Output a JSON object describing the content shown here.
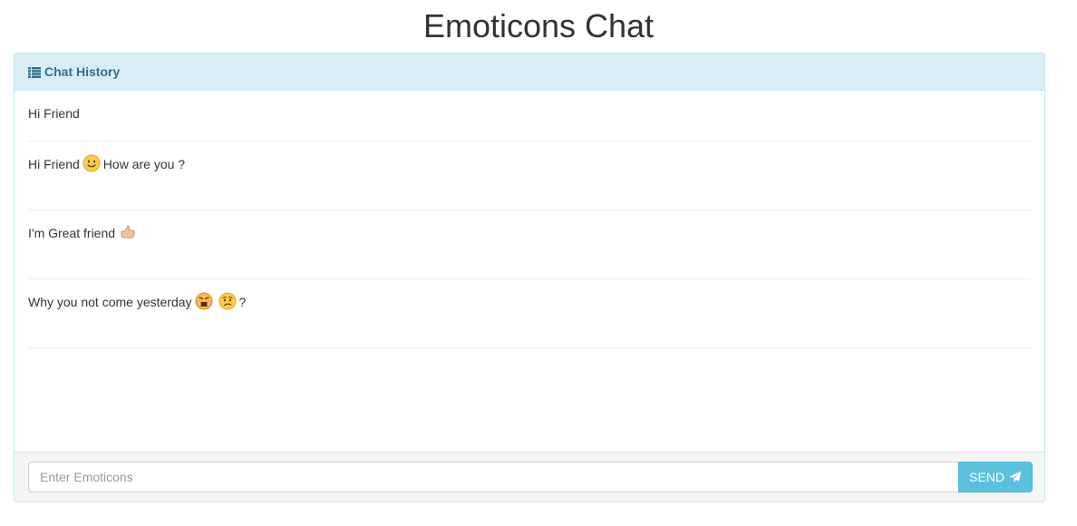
{
  "page": {
    "title": "Emoticons Chat"
  },
  "panel": {
    "heading": "Chat History",
    "heading_icon": "list-icon"
  },
  "messages": [
    {
      "parts": [
        {
          "text": "Hi Friend"
        }
      ]
    },
    {
      "parts": [
        {
          "text": "Hi Friend"
        },
        {
          "emoji": "smile-emoji-icon"
        },
        {
          "text": "How are you ?"
        }
      ]
    },
    {
      "parts": [
        {
          "text": "I'm Great friend"
        },
        {
          "emoji": "thumbs-up-emoji-icon"
        }
      ]
    },
    {
      "parts": [
        {
          "text": "Why you not come yesterday"
        },
        {
          "emoji": "angry-emoji-icon"
        },
        {
          "emoji": "confused-emoji-icon"
        },
        {
          "text": "?"
        }
      ]
    }
  ],
  "footer": {
    "input_placeholder": "Enter Emoticons",
    "input_value": "",
    "send_label": "SEND",
    "send_icon": "paper-plane-icon"
  },
  "colors": {
    "heading_bg": "#d9edf7",
    "heading_text": "#31708f",
    "send_bg": "#5bc0de"
  }
}
